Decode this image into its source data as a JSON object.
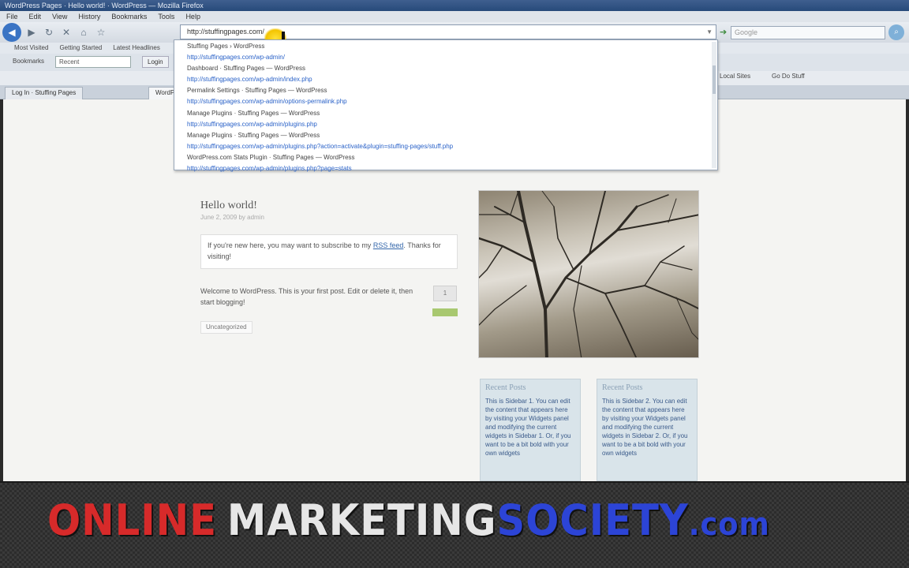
{
  "window": {
    "title": "WordPress Pages · Hello world! · WordPress — Mozilla Firefox"
  },
  "menubar": [
    "File",
    "Edit",
    "View",
    "History",
    "Bookmarks",
    "Tools",
    "Help"
  ],
  "navbar": {
    "url": "http://stuffingpages.com/",
    "search_placeholder": "Google"
  },
  "bookmarks": [
    "Most Visited",
    "Getting Started",
    "Latest Headlines"
  ],
  "toolbar3": {
    "label": "Bookmarks",
    "select_value": "Recent",
    "login_label": "Login"
  },
  "toolbar4": {
    "right_a": "Local Sites",
    "right_b": "Go Do Stuff"
  },
  "tabs": [
    "Log In · Stuffing Pages",
    "WordPress"
  ],
  "autocomplete": [
    {
      "title": "Stuffing Pages › WordPress",
      "url": "http://stuffingpages.com/wp-admin/"
    },
    {
      "title": "Dashboard · Stuffing Pages — WordPress",
      "url": "http://stuffingpages.com/wp-admin/index.php"
    },
    {
      "title": "Permalink Settings · Stuffing Pages — WordPress",
      "url": "http://stuffingpages.com/wp-admin/options-permalink.php"
    },
    {
      "title": "Manage Plugins · Stuffing Pages — WordPress",
      "url": "http://stuffingpages.com/wp-admin/plugins.php"
    },
    {
      "title": "Manage Plugins · Stuffing Pages — WordPress",
      "url": "http://stuffingpages.com/wp-admin/plugins.php?action=activate&plugin=stuffing-pages/stuff.php"
    },
    {
      "title": "WordPress.com Stats Plugin · Stuffing Pages — WordPress",
      "url": "http://stuffingpages.com/wp-admin/plugins.php?page=stats"
    }
  ],
  "post": {
    "title": "Hello world!",
    "date": "June 2, 2009 by admin",
    "notice_text": "If you're new here, you may want to subscribe to my",
    "notice_link": "RSS feed",
    "notice_tail": ". Thanks for visiting!",
    "body": "Welcome to WordPress. This is your first post. Edit or delete it, then start blogging!",
    "comment_count": "1",
    "meta": "Uncategorized"
  },
  "sidebar": {
    "left_title": "Recent Posts",
    "left_body": "This is Sidebar 1. You can edit the content that appears here by visiting your Widgets panel and modifying the current widgets in Sidebar 1. Or, if you want to be a bit bold with your own widgets",
    "right_title": "Recent Posts",
    "right_body": "This is Sidebar 2. You can edit the content that appears here by visiting your Widgets panel and modifying the current widgets in Sidebar 2. Or, if you want to be a bit bold with your own widgets"
  },
  "banner": {
    "word1": "ONLINE",
    "word2": "MARKETING",
    "word3": "SOCIETY",
    "word4": ".com"
  },
  "colors": {
    "banner_red": "#d72a2a",
    "banner_blue": "#2c44d6",
    "link_blue": "#2a62c8"
  }
}
